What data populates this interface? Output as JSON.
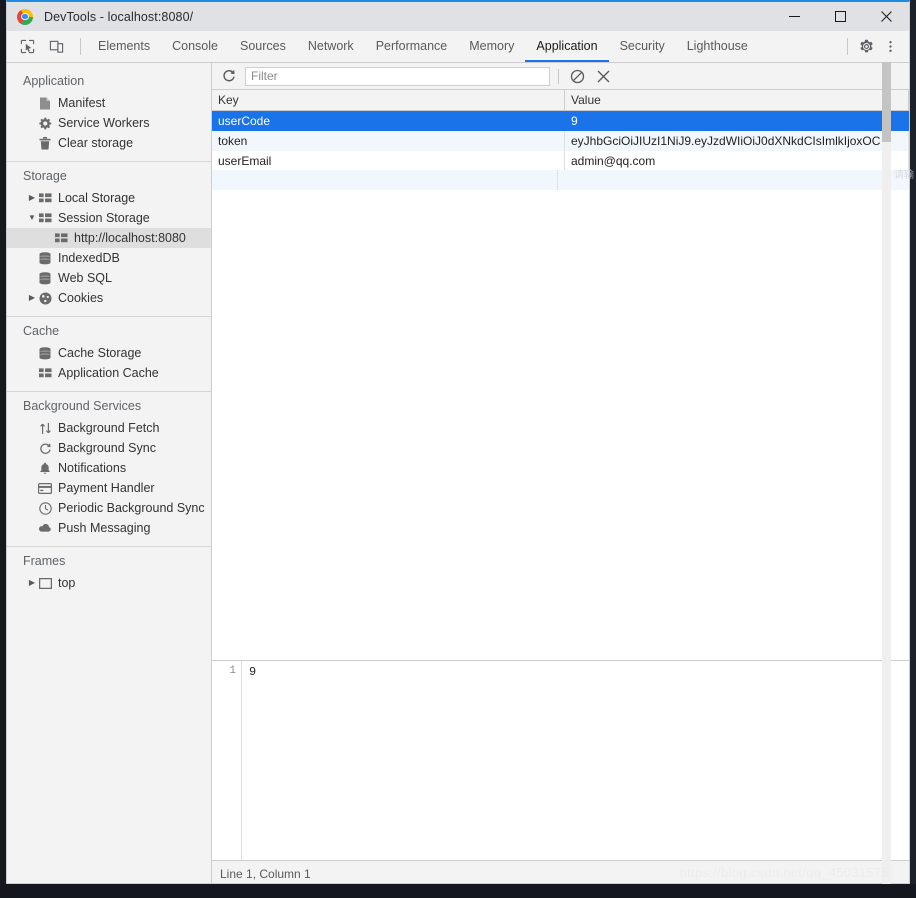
{
  "window": {
    "title": "DevTools - localhost:8080/",
    "logo_icon": "chrome-logo-icon",
    "minimize_label": "—",
    "maximize_label": "□",
    "close_label": "✕"
  },
  "toolbar": {
    "inspect_icon": "inspect-element-icon",
    "device_icon": "device-toolbar-icon",
    "settings_icon": "gear-icon",
    "more_icon": "more-vertical-icon",
    "tabs": [
      {
        "label": "Elements",
        "active": false
      },
      {
        "label": "Console",
        "active": false
      },
      {
        "label": "Sources",
        "active": false
      },
      {
        "label": "Network",
        "active": false
      },
      {
        "label": "Performance",
        "active": false
      },
      {
        "label": "Memory",
        "active": false
      },
      {
        "label": "Application",
        "active": true
      },
      {
        "label": "Security",
        "active": false
      },
      {
        "label": "Lighthouse",
        "active": false
      }
    ]
  },
  "sidebar": {
    "groups": [
      {
        "title": "Application",
        "items": [
          {
            "label": "Manifest",
            "icon": "manifest-file-icon",
            "indent": 1,
            "twisty": "",
            "selected": false
          },
          {
            "label": "Service Workers",
            "icon": "gear-icon",
            "indent": 1,
            "twisty": "",
            "selected": false
          },
          {
            "label": "Clear storage",
            "icon": "trash-icon",
            "indent": 1,
            "twisty": "",
            "selected": false
          }
        ]
      },
      {
        "title": "Storage",
        "items": [
          {
            "label": "Local Storage",
            "icon": "table-grid-icon",
            "indent": 1,
            "twisty": "collapsed",
            "selected": false
          },
          {
            "label": "Session Storage",
            "icon": "table-grid-icon",
            "indent": 1,
            "twisty": "expanded",
            "selected": false
          },
          {
            "label": "http://localhost:8080",
            "icon": "table-grid-icon",
            "indent": 2,
            "twisty": "",
            "selected": true
          },
          {
            "label": "IndexedDB",
            "icon": "database-icon",
            "indent": 1,
            "twisty": "",
            "selected": false
          },
          {
            "label": "Web SQL",
            "icon": "database-icon",
            "indent": 1,
            "twisty": "",
            "selected": false
          },
          {
            "label": "Cookies",
            "icon": "cookie-icon",
            "indent": 1,
            "twisty": "collapsed",
            "selected": false
          }
        ]
      },
      {
        "title": "Cache",
        "items": [
          {
            "label": "Cache Storage",
            "icon": "database-icon",
            "indent": 1,
            "twisty": "",
            "selected": false
          },
          {
            "label": "Application Cache",
            "icon": "table-grid-icon",
            "indent": 1,
            "twisty": "",
            "selected": false
          }
        ]
      },
      {
        "title": "Background Services",
        "items": [
          {
            "label": "Background Fetch",
            "icon": "up-down-arrows-icon",
            "indent": 1,
            "twisty": "",
            "selected": false
          },
          {
            "label": "Background Sync",
            "icon": "sync-icon",
            "indent": 1,
            "twisty": "",
            "selected": false
          },
          {
            "label": "Notifications",
            "icon": "bell-icon",
            "indent": 1,
            "twisty": "",
            "selected": false
          },
          {
            "label": "Payment Handler",
            "icon": "credit-card-icon",
            "indent": 1,
            "twisty": "",
            "selected": false
          },
          {
            "label": "Periodic Background Sync",
            "icon": "clock-icon",
            "indent": 1,
            "twisty": "",
            "selected": false
          },
          {
            "label": "Push Messaging",
            "icon": "cloud-icon",
            "indent": 1,
            "twisty": "",
            "selected": false
          }
        ]
      },
      {
        "title": "Frames",
        "items": [
          {
            "label": "top",
            "icon": "frame-icon",
            "indent": 1,
            "twisty": "collapsed",
            "selected": false
          }
        ]
      }
    ]
  },
  "filterbar": {
    "refresh_icon": "refresh-icon",
    "filter_placeholder": "Filter",
    "filter_value": "",
    "clear_all_icon": "clear-all-icon",
    "delete_selected_icon": "close-x-icon"
  },
  "storage_table": {
    "columns": [
      "Key",
      "Value"
    ],
    "rows": [
      {
        "key": "userCode",
        "value": "9",
        "selected": true
      },
      {
        "key": "token",
        "value": "eyJhbGciOiJIUzI1NiJ9.eyJzdWIiOiJ0dXNkdCIsImlkIjoxOC…",
        "selected": false
      },
      {
        "key": "userEmail",
        "value": "admin@qq.com",
        "selected": false
      }
    ]
  },
  "preview": {
    "line_number": "1",
    "content": "9",
    "status": "Line 1, Column 1"
  },
  "watermark": {
    "text": "https://blog.csdn.net/qq_45031575"
  },
  "sidelabel": {
    "text": "请输"
  },
  "colors": {
    "accent": "#1a73e8",
    "titlebar": "#dfe1e5",
    "toolbar": "#f3f3f3",
    "selected_row": "#1a73e8",
    "alt_row": "#f2f7fd",
    "top_border": "#1e8ae0"
  }
}
